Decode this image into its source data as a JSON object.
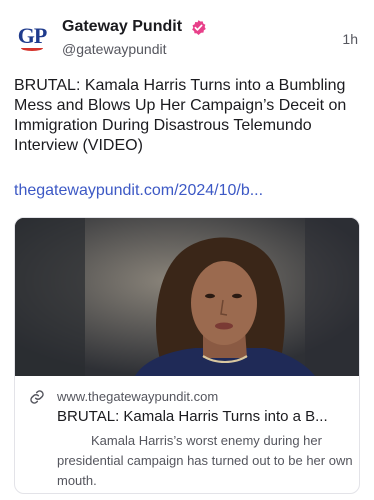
{
  "author": {
    "avatar_text": "GP",
    "name": "Gateway Pundit",
    "handle": "@gatewaypundit",
    "timestamp": "1h",
    "verified_icon": "verified-badge-icon",
    "verified_color": "#e8408a"
  },
  "post": {
    "text": "BRUTAL: Kamala Harris Turns into a Bumbling Mess and Blows Up Her Campaign’s Deceit on Immigration During Disastrous Telemundo Interview (VIDEO)",
    "link": "thegatewaypundit.com/2024/10/b..."
  },
  "card": {
    "image_icon": "photo-thumbnail",
    "link_icon": "link-icon",
    "domain": "www.thegatewaypundit.com",
    "title": "BRUTAL: Kamala Harris Turns into a B...",
    "description": "Kamala Harris’s worst enemy during her presidential campaign has turned out to be her own mouth."
  },
  "colors": {
    "link": "#3d59c5",
    "text": "#1b1b1f",
    "muted": "#55565e",
    "border": "#e3e3e8"
  }
}
